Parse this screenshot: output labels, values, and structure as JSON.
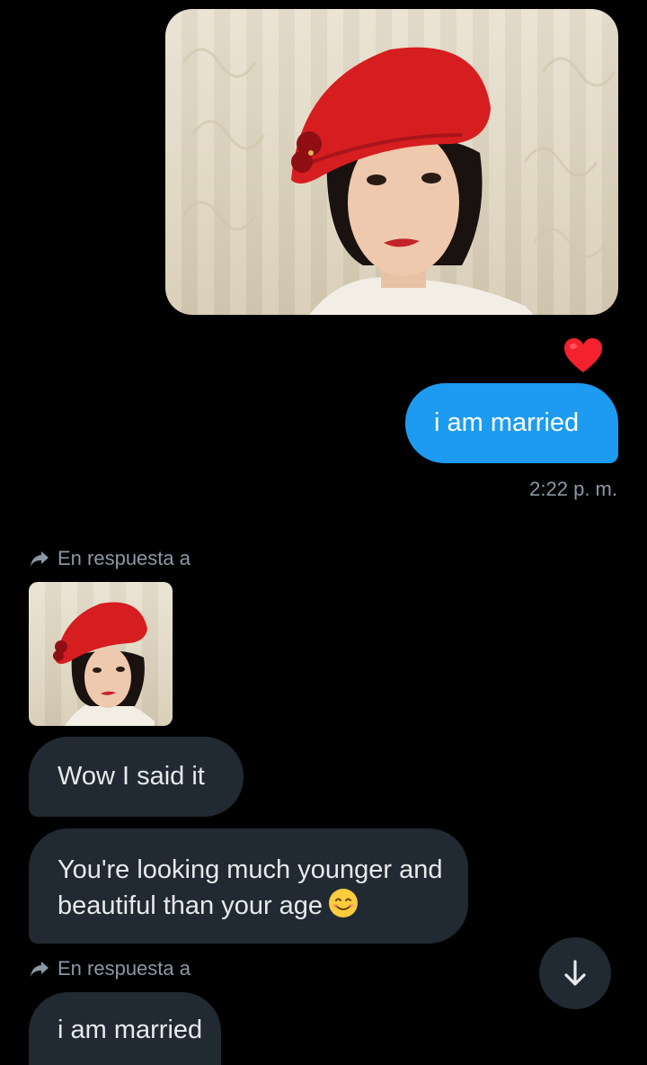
{
  "messages": {
    "sent_text": "i am married",
    "timestamp": "2:22 p. m.",
    "reply_label": "En respuesta a",
    "wow_text": "Wow I said it",
    "younger_text": "You're looking much younger and beautiful than your age",
    "married_text": "i am married"
  },
  "reaction": {
    "icon": "red-heart-icon",
    "color": "#f4212e"
  },
  "icons": {
    "reply": "reply-arrow-icon",
    "scroll": "arrow-down-icon",
    "emoji": "smiling-face-icon"
  },
  "colors": {
    "background": "#000000",
    "outgoing_bubble": "#1d9bf0",
    "incoming_bubble": "#212a32",
    "secondary_text": "#8b98a5"
  }
}
